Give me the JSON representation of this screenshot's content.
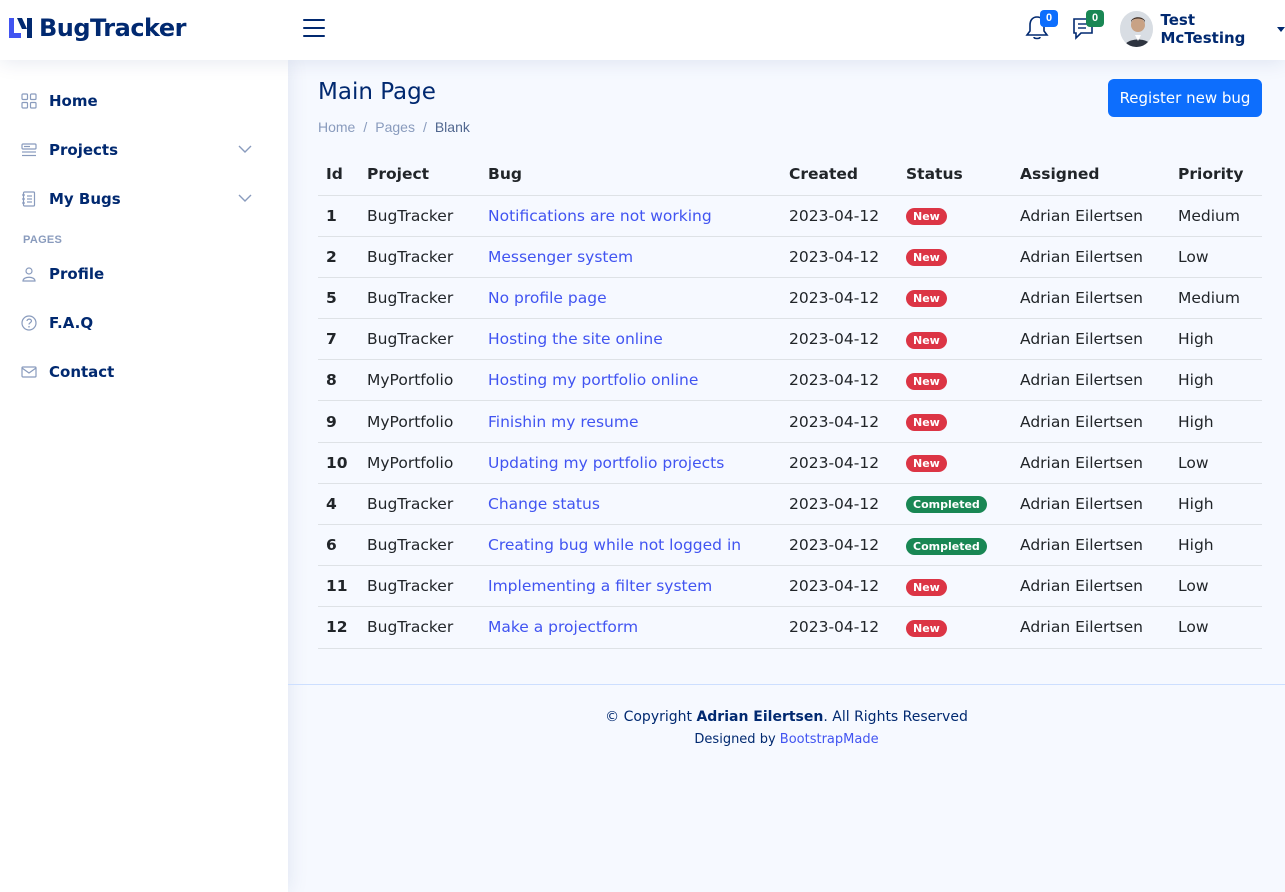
{
  "app": {
    "brand": "BugTracker"
  },
  "header": {
    "notifications_count": "0",
    "messages_count": "0",
    "user_name": "Test McTesting"
  },
  "sidebar": {
    "items": [
      {
        "label": "Home",
        "icon": "grid-icon"
      },
      {
        "label": "Projects",
        "icon": "menu-button-icon"
      },
      {
        "label": "My Bugs",
        "icon": "journal-icon"
      }
    ],
    "heading": "PAGES",
    "pages": [
      {
        "label": "Profile",
        "icon": "person-icon"
      },
      {
        "label": "F.A.Q",
        "icon": "question-circle-icon"
      },
      {
        "label": "Contact",
        "icon": "envelope-icon"
      }
    ]
  },
  "main": {
    "title": "Main Page",
    "breadcrumb": [
      "Home",
      "Pages",
      "Blank"
    ],
    "register_button": "Register new bug"
  },
  "table": {
    "headers": [
      "Id",
      "Project",
      "Bug",
      "Created",
      "Status",
      "Assigned",
      "Priority"
    ],
    "rows": [
      {
        "id": "1",
        "project": "BugTracker",
        "bug": "Notifications are not working",
        "created": "2023-04-12",
        "status": "New",
        "assigned": "Adrian Eilertsen",
        "priority": "Medium"
      },
      {
        "id": "2",
        "project": "BugTracker",
        "bug": "Messenger system",
        "created": "2023-04-12",
        "status": "New",
        "assigned": "Adrian Eilertsen",
        "priority": "Low"
      },
      {
        "id": "5",
        "project": "BugTracker",
        "bug": "No profile page",
        "created": "2023-04-12",
        "status": "New",
        "assigned": "Adrian Eilertsen",
        "priority": "Medium"
      },
      {
        "id": "7",
        "project": "BugTracker",
        "bug": "Hosting the site online",
        "created": "2023-04-12",
        "status": "New",
        "assigned": "Adrian Eilertsen",
        "priority": "High"
      },
      {
        "id": "8",
        "project": "MyPortfolio",
        "bug": "Hosting my portfolio online",
        "created": "2023-04-12",
        "status": "New",
        "assigned": "Adrian Eilertsen",
        "priority": "High"
      },
      {
        "id": "9",
        "project": "MyPortfolio",
        "bug": "Finishin my resume",
        "created": "2023-04-12",
        "status": "New",
        "assigned": "Adrian Eilertsen",
        "priority": "High"
      },
      {
        "id": "10",
        "project": "MyPortfolio",
        "bug": "Updating my portfolio projects",
        "created": "2023-04-12",
        "status": "New",
        "assigned": "Adrian Eilertsen",
        "priority": "Low"
      },
      {
        "id": "4",
        "project": "BugTracker",
        "bug": "Change status",
        "created": "2023-04-12",
        "status": "Completed",
        "assigned": "Adrian Eilertsen",
        "priority": "High"
      },
      {
        "id": "6",
        "project": "BugTracker",
        "bug": "Creating bug while not logged in",
        "created": "2023-04-12",
        "status": "Completed",
        "assigned": "Adrian Eilertsen",
        "priority": "High"
      },
      {
        "id": "11",
        "project": "BugTracker",
        "bug": "Implementing a filter system",
        "created": "2023-04-12",
        "status": "New",
        "assigned": "Adrian Eilertsen",
        "priority": "Low"
      },
      {
        "id": "12",
        "project": "BugTracker",
        "bug": "Make a projectform",
        "created": "2023-04-12",
        "status": "New",
        "assigned": "Adrian Eilertsen",
        "priority": "Low"
      }
    ]
  },
  "status_colors": {
    "New": "#dc3545",
    "Completed": "#198754"
  },
  "footer": {
    "copyright_prefix": "© Copyright ",
    "copyright_name": "Adrian Eilertsen",
    "copyright_suffix": ". All Rights Reserved",
    "designed_by": "Designed by ",
    "designer_link": "BootstrapMade"
  }
}
